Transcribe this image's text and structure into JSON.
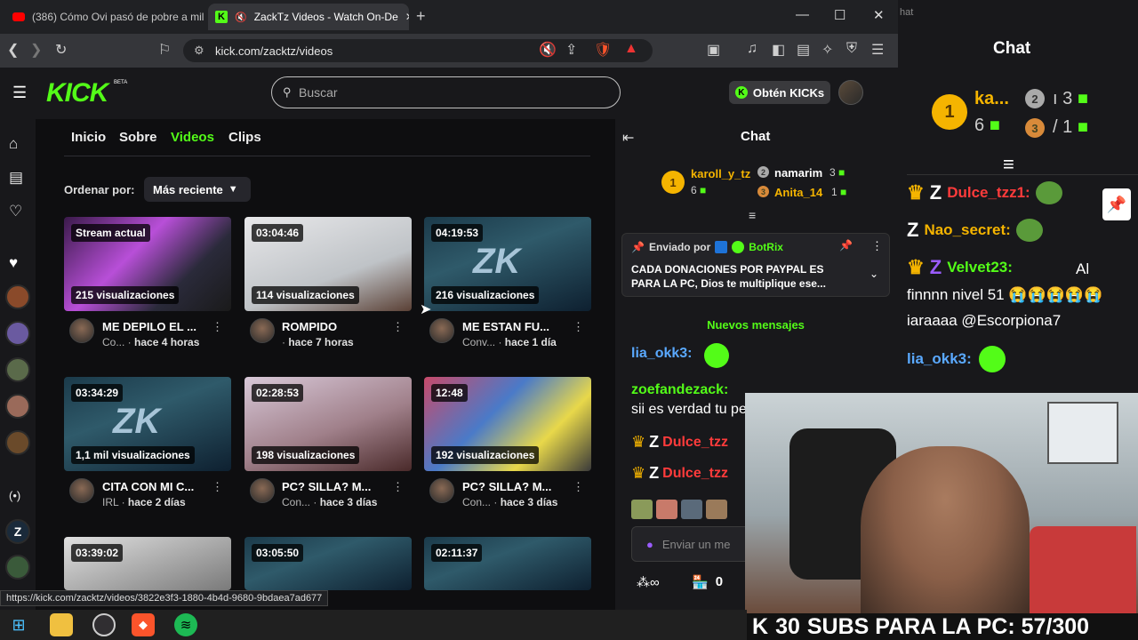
{
  "browser": {
    "tabs": [
      {
        "title": "(386) Cómo Ovi pasó de pobre a mil"
      },
      {
        "title": "ZackTz Videos - Watch On-De"
      }
    ],
    "new_tab": "+",
    "url": "kick.com/zacktz/videos",
    "status_url": "https://kick.com/zacktz/videos/3822e3f3-1880-4b4d-9680-9bdaea7ad677"
  },
  "kick": {
    "logo": "KICK",
    "beta": "BETA",
    "search_placeholder": "Buscar",
    "get_kicks": "Obtén KICKs"
  },
  "channel_nav": {
    "tabs": [
      "Inicio",
      "Sobre",
      "Videos",
      "Clips"
    ],
    "active": "Videos",
    "sort_label": "Ordenar por:",
    "sort_value": "Más reciente"
  },
  "videos": [
    {
      "badge": "Stream actual",
      "views": "215 visualizaciones",
      "title": "ME DEPILO EL ...",
      "channel": "Co...",
      "ago": "hace 4 horas"
    },
    {
      "badge": "03:04:46",
      "views": "114 visualizaciones",
      "title": "ROMPIDO",
      "channel": "",
      "ago": "hace 7 horas"
    },
    {
      "badge": "04:19:53",
      "views": "216 visualizaciones",
      "title": "ME ESTAN FU...",
      "channel": "Conv...",
      "ago": "hace 1 día"
    },
    {
      "badge": "03:34:29",
      "views": "1,1 mil visualizaciones",
      "title": "CITA CON MI C...",
      "channel": "IRL",
      "ago": "hace 2 días"
    },
    {
      "badge": "02:28:53",
      "views": "198 visualizaciones",
      "title": "PC? SILLA? M...",
      "channel": "Con...",
      "ago": "hace 3 días"
    },
    {
      "badge": "12:48",
      "views": "192 visualizaciones",
      "title": "PC? SILLA? M...",
      "channel": "Con...",
      "ago": "hace 3 días"
    },
    {
      "badge": "03:39:02",
      "views": "",
      "title": "",
      "channel": "",
      "ago": ""
    },
    {
      "badge": "03:05:50",
      "views": "",
      "title": "",
      "channel": "",
      "ago": ""
    },
    {
      "badge": "02:11:37",
      "views": "",
      "title": "",
      "channel": "",
      "ago": ""
    }
  ],
  "thumb_art": "ZK",
  "chat_panel": {
    "title": "Chat",
    "leaderboard": {
      "first": {
        "rank": "1",
        "name": "karoll_y_tz",
        "gifts": "6"
      },
      "second": {
        "rank": "2",
        "name": "namarim",
        "gifts": "3"
      },
      "third": {
        "rank": "3",
        "name": "Anita_14",
        "gifts": "1"
      }
    },
    "pinned": {
      "by_label": "Enviado por",
      "by_user": "BotRix",
      "text": "CADA DONACIONES POR PAYPAL ES PARA LA PC, Dios te multiplique ese..."
    },
    "new_messages": "Nuevos mensajes",
    "messages": [
      {
        "user": "lia_okk3:",
        "text": ""
      },
      {
        "user": "zoefandezack:",
        "text": "sii es verdad tu personalidad hu"
      },
      {
        "user": "Dulce_tzz",
        "text": ""
      },
      {
        "user": "Dulce_tzz",
        "text": ""
      }
    ],
    "input_placeholder": "Enviar un me",
    "footer_count": "0"
  },
  "overlay_chat": {
    "header_cut": "hat",
    "title": "Chat",
    "leaderboard": {
      "first": "ka...",
      "first_gifts": "6",
      "second": "3",
      "third": "1"
    },
    "messages": [
      {
        "user": "Dulce_tzz1:",
        "text": ""
      },
      {
        "user": "Nao_secret:",
        "text": ""
      },
      {
        "user": "Velvet23:",
        "text": "Al finnnn nivel 51 😭😭😭😭😭 iaraaaa @Escorpiona7"
      },
      {
        "user": "lia_okk3:",
        "text": ""
      }
    ]
  },
  "subs_banner": {
    "count": "30",
    "text": "SUBS PARA LA PC: 57/300"
  },
  "colors": {
    "kick_green": "#53fc18",
    "background": "#0e0e10",
    "panel": "#18181b",
    "coin": "#f5b400",
    "red_name": "#ff3b3b",
    "purple_name": "#9b5cff"
  },
  "icons": {
    "sidebar": [
      "home-icon",
      "browse-icon",
      "following-icon",
      "heart-icon",
      "live-icon",
      "z-channel-icon"
    ],
    "taskbar": [
      "windows-start-icon",
      "file-explorer-icon",
      "obs-icon",
      "brave-icon",
      "spotify-icon"
    ]
  }
}
